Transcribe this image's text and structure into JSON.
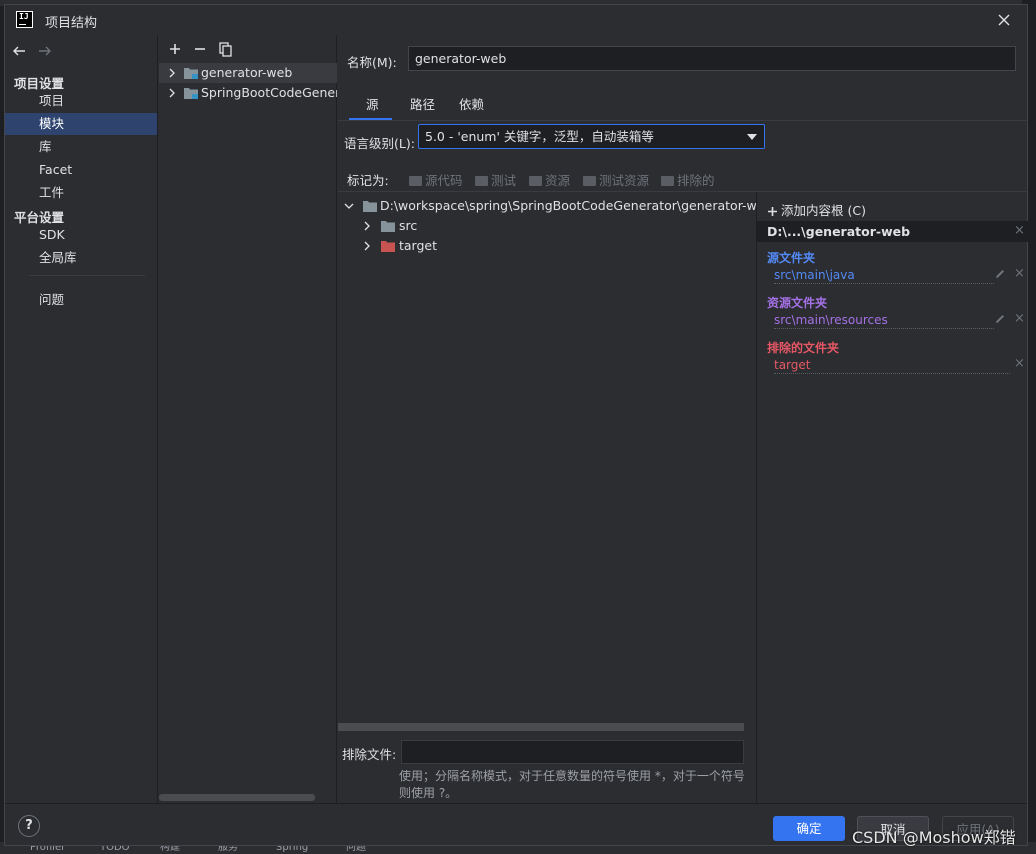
{
  "window": {
    "title": "项目结构",
    "logo_text": "IJ"
  },
  "nav": {
    "sections": [
      {
        "title": "项目设置",
        "items": [
          "项目",
          "模块",
          "库",
          "Facet",
          "工件"
        ]
      },
      {
        "title": "平台设置",
        "items": [
          "SDK",
          "全局库"
        ]
      }
    ],
    "extra_item": "问题",
    "selected": "模块"
  },
  "modules": {
    "items": [
      "generator-web",
      "SpringBootCodeGenerator"
    ],
    "selected": "generator-web"
  },
  "module_settings": {
    "name_label": "名称(M):",
    "name_value": "generator-web",
    "tabs": [
      "源",
      "路径",
      "依赖"
    ],
    "active_tab": "源",
    "language_level_label": "语言级别(L):",
    "language_level_value": "5.0 - 'enum' 关键字，泛型，自动装箱等",
    "mark_as_label": "标记为:",
    "mark_as_buttons": [
      "源代码",
      "测试",
      "资源",
      "测试资源",
      "排除的"
    ],
    "tree": {
      "root": "D:\\workspace\\spring\\SpringBootCodeGenerator\\generator-web",
      "children": [
        "src",
        "target"
      ]
    },
    "exclude_files_label": "排除文件:",
    "exclude_files_value": "",
    "exclude_help": "使用；分隔名称模式，对于任意数量的符号使用 *，对于一个符号则使用 ?。"
  },
  "content_roots": {
    "add_label": "添加内容根 (C)",
    "root_path": "D:\\...\\generator-web",
    "source_title": "源文件夹",
    "source_entry": "src\\main\\java",
    "resource_title": "资源文件夹",
    "resource_entry": "src\\main\\resources",
    "excluded_title": "排除的文件夹",
    "excluded_entry": "target"
  },
  "footer": {
    "help": "?",
    "ok": "确定",
    "cancel": "取消",
    "apply": "应用(A)"
  },
  "background": {
    "tools": [
      "Profiler",
      "TODO",
      "构建",
      "服务",
      "Spring",
      "问题"
    ]
  },
  "watermark": "CSDN @Moshow郑锴",
  "colors": {
    "accent": "#3574f0",
    "selection": "#2e436e",
    "source": "#548af7",
    "resource": "#a571e6",
    "excluded": "#e55765",
    "folder_excluded": "#c75450"
  }
}
